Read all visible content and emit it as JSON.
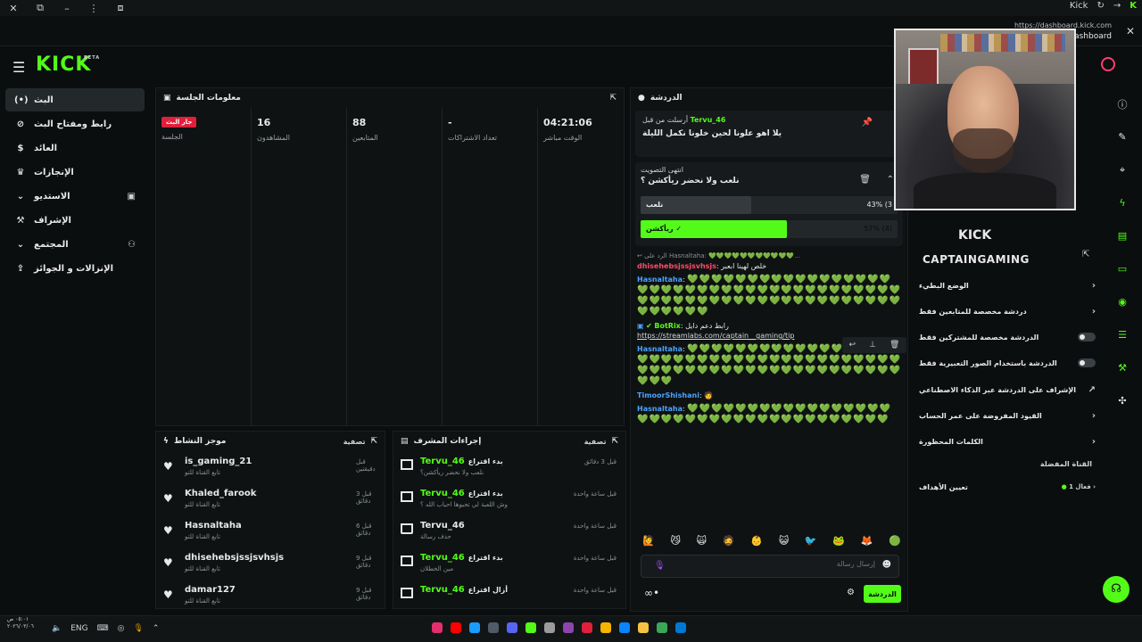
{
  "browser": {
    "app_name": "Kick",
    "url": "https://dashboard.kick.com",
    "dashboard_label": "Dashboard"
  },
  "header": {
    "logo": "KICK",
    "logo_tag": "BETA"
  },
  "sidebar": {
    "items": [
      {
        "label": "البث",
        "icon": "(•)",
        "active": true
      },
      {
        "label": "رابط ومفتاح البث",
        "icon": "🔗"
      },
      {
        "label": "العائد",
        "icon": "$"
      },
      {
        "label": "الإنجازات",
        "icon": "🏆"
      },
      {
        "label": "الاستديو",
        "icon": "⌄"
      },
      {
        "label": "الإشراف",
        "icon": "🔨"
      },
      {
        "label": "المجتمع",
        "icon": "⌄"
      },
      {
        "label": "الإنزالات و الجوائز",
        "icon": "⇪"
      }
    ]
  },
  "session": {
    "title": "معلومات الجلسة",
    "stats": [
      {
        "value": "جار البث",
        "label": "الجلسة",
        "is_badge": true
      },
      {
        "value": "16",
        "label": "المشاهدون"
      },
      {
        "value": "88",
        "label": "المتابعين"
      },
      {
        "value": "-",
        "label": "تعداد الاشتراكات"
      },
      {
        "value": "04:21:06",
        "label": "الوقت مباشر"
      }
    ]
  },
  "activity": {
    "title": "موجز النشاط",
    "filter": "تصفية",
    "rows": [
      {
        "name": "is_gaming_21",
        "sub": "تابع القناة للتو",
        "time": "قبل دقيقتين"
      },
      {
        "name": "Khaled_farook",
        "sub": "تابع القناة للتو",
        "time": "قبل 3 دقائق"
      },
      {
        "name": "Hasnaltaha",
        "sub": "تابع القناة للتو",
        "time": "قبل 6 دقائق"
      },
      {
        "name": "dhisehebsjssjsvhsjs",
        "sub": "تابع القناة للتو",
        "time": "قبل 9 دقائق"
      },
      {
        "name": "damar127",
        "sub": "تابع القناة للتو",
        "time": "قبل 9 دقائق"
      }
    ]
  },
  "mod_actions": {
    "title": "إجراءات المشرف",
    "filter": "تصفية",
    "rows": [
      {
        "name": "Tervu_46",
        "action": "بدء اقتراع",
        "sub": "نلعب ولا نحضر ريأكشن؟",
        "time": "قبل 3 دقائق",
        "icon": "poll"
      },
      {
        "name": "Tervu_46",
        "action": "بدء اقتراع",
        "sub": "وش اللعبة لي تحبوها احباب الله ؟",
        "time": "قبل ساعة واحدة",
        "icon": "poll"
      },
      {
        "name": "Tervu_46",
        "action": "",
        "sub": "حذف رسالة",
        "time": "قبل ساعة واحدة",
        "icon": "trash"
      },
      {
        "name": "Tervu_46",
        "action": "بدء اقتراع",
        "sub": "مين الخطلان",
        "time": "قبل ساعة واحدة",
        "icon": "poll"
      },
      {
        "name": "Tervu_46",
        "action": "أزال اقتراع",
        "sub": "",
        "time": "قبل ساعة واحدة",
        "icon": "poll"
      }
    ]
  },
  "chat": {
    "title": "الدردشة",
    "pinned": {
      "by_label": "أرسلت من قبل",
      "by": "Tervu_46",
      "text": "يلا اهو علونا لحين خلونا نكمل الليلة"
    },
    "poll": {
      "status": "انتهى التصويت",
      "question": "نلعب ولا نحضر ريأكشن ؟",
      "options": [
        {
          "label": "نلعب",
          "percent": 43,
          "count": "(3",
          "winner": false
        },
        {
          "label": "ريأكشن",
          "percent": 57,
          "count": "(4)",
          "winner": true
        }
      ]
    },
    "messages": [
      {
        "type": "reply",
        "reply_to": "Hasnaltaha",
        "reply_label": "الرد على",
        "user": "dhisehebsjssjsvhsjs",
        "user_color": "#ff4b6b",
        "text": "خلص لهينا ابعبر"
      },
      {
        "type": "hearts",
        "user": "Hasnaltaha",
        "user_color": "#4aa3ff",
        "hearts": "💚💚💚💚💚💚💚💚💚💚💚💚💚💚💚💚💚💚💚💚💚💚💚💚💚💚💚💚💚💚💚💚💚💚💚💚💚💚💚💚💚💚💚💚💚💚💚💚💚💚💚💚💚💚💚💚💚💚💚💚💚💚💚💚💚💚💚"
      },
      {
        "type": "bot",
        "user": "BotRix",
        "user_color": "#53fc18",
        "text": "رابط دعم دايل",
        "link": "https://streamlabs.com/captain__gaming/tip"
      },
      {
        "type": "hearts",
        "user": "Hasnaltaha",
        "user_color": "#4aa3ff",
        "hearts": "💚💚💚💚💚💚💚💚💚💚💚💚💚💚💚💚💚💚💚💚💚💚💚💚💚💚💚💚💚💚💚💚💚💚💚💚💚💚💚💚💚💚💚💚💚💚💚💚💚💚💚💚💚💚💚💚💚💚💚💚💚💚💚💚"
      },
      {
        "type": "text",
        "user": "TimoorShishani",
        "user_color": "#4aa3ff",
        "text": "🧑"
      },
      {
        "type": "hearts",
        "user": "Hasnaltaha",
        "user_color": "#4aa3ff",
        "hearts": "💚💚💚💚💚💚💚💚💚💚💚💚💚💚💚💚💚💚💚💚💚💚💚💚💚💚💚💚💚💚💚💚💚💚💚💚💚💚"
      }
    ],
    "emotes": [
      "🙋",
      "😼",
      "🙀",
      "🧔",
      "👶",
      "😺",
      "🐦",
      "🐸",
      "🦊",
      "🟢"
    ],
    "input_placeholder": "إرسال رسالة",
    "send_label": "الدردشة"
  },
  "chat_settings": {
    "logo": "KICK",
    "channel": "CAPTAINGAMING",
    "rows": [
      {
        "label": "الوضع البطيء",
        "control": "chevron"
      },
      {
        "label": "دردشة مخصصة للمتابعين فقط",
        "control": "chevron"
      },
      {
        "label": "الدردشة مخصصة للمشتركين فقط",
        "control": "toggle"
      },
      {
        "label": "الدردشة باستخدام الصور التعبيرية فقط",
        "control": "toggle"
      },
      {
        "label": "الإشراف على الدردشة عبر الذكاء الاصطناعي",
        "control": "link"
      },
      {
        "label": "القيود المفروضة على عمر الحساب",
        "control": "chevron"
      },
      {
        "label": "الكلمات المحظورة",
        "control": "chevron"
      }
    ],
    "section": "القناة المفضلة",
    "goal": {
      "label": "تعيين الأهداف",
      "badge": "1 فعال"
    }
  },
  "taskbar": {
    "lang": "ENG",
    "time": "٠٥:٠١ ص",
    "date": "٢٠٢٦/٠٣/٠٦"
  },
  "colors": {
    "accent": "#53fc18",
    "live": "#e0203b",
    "background": "#0b0e0f"
  }
}
